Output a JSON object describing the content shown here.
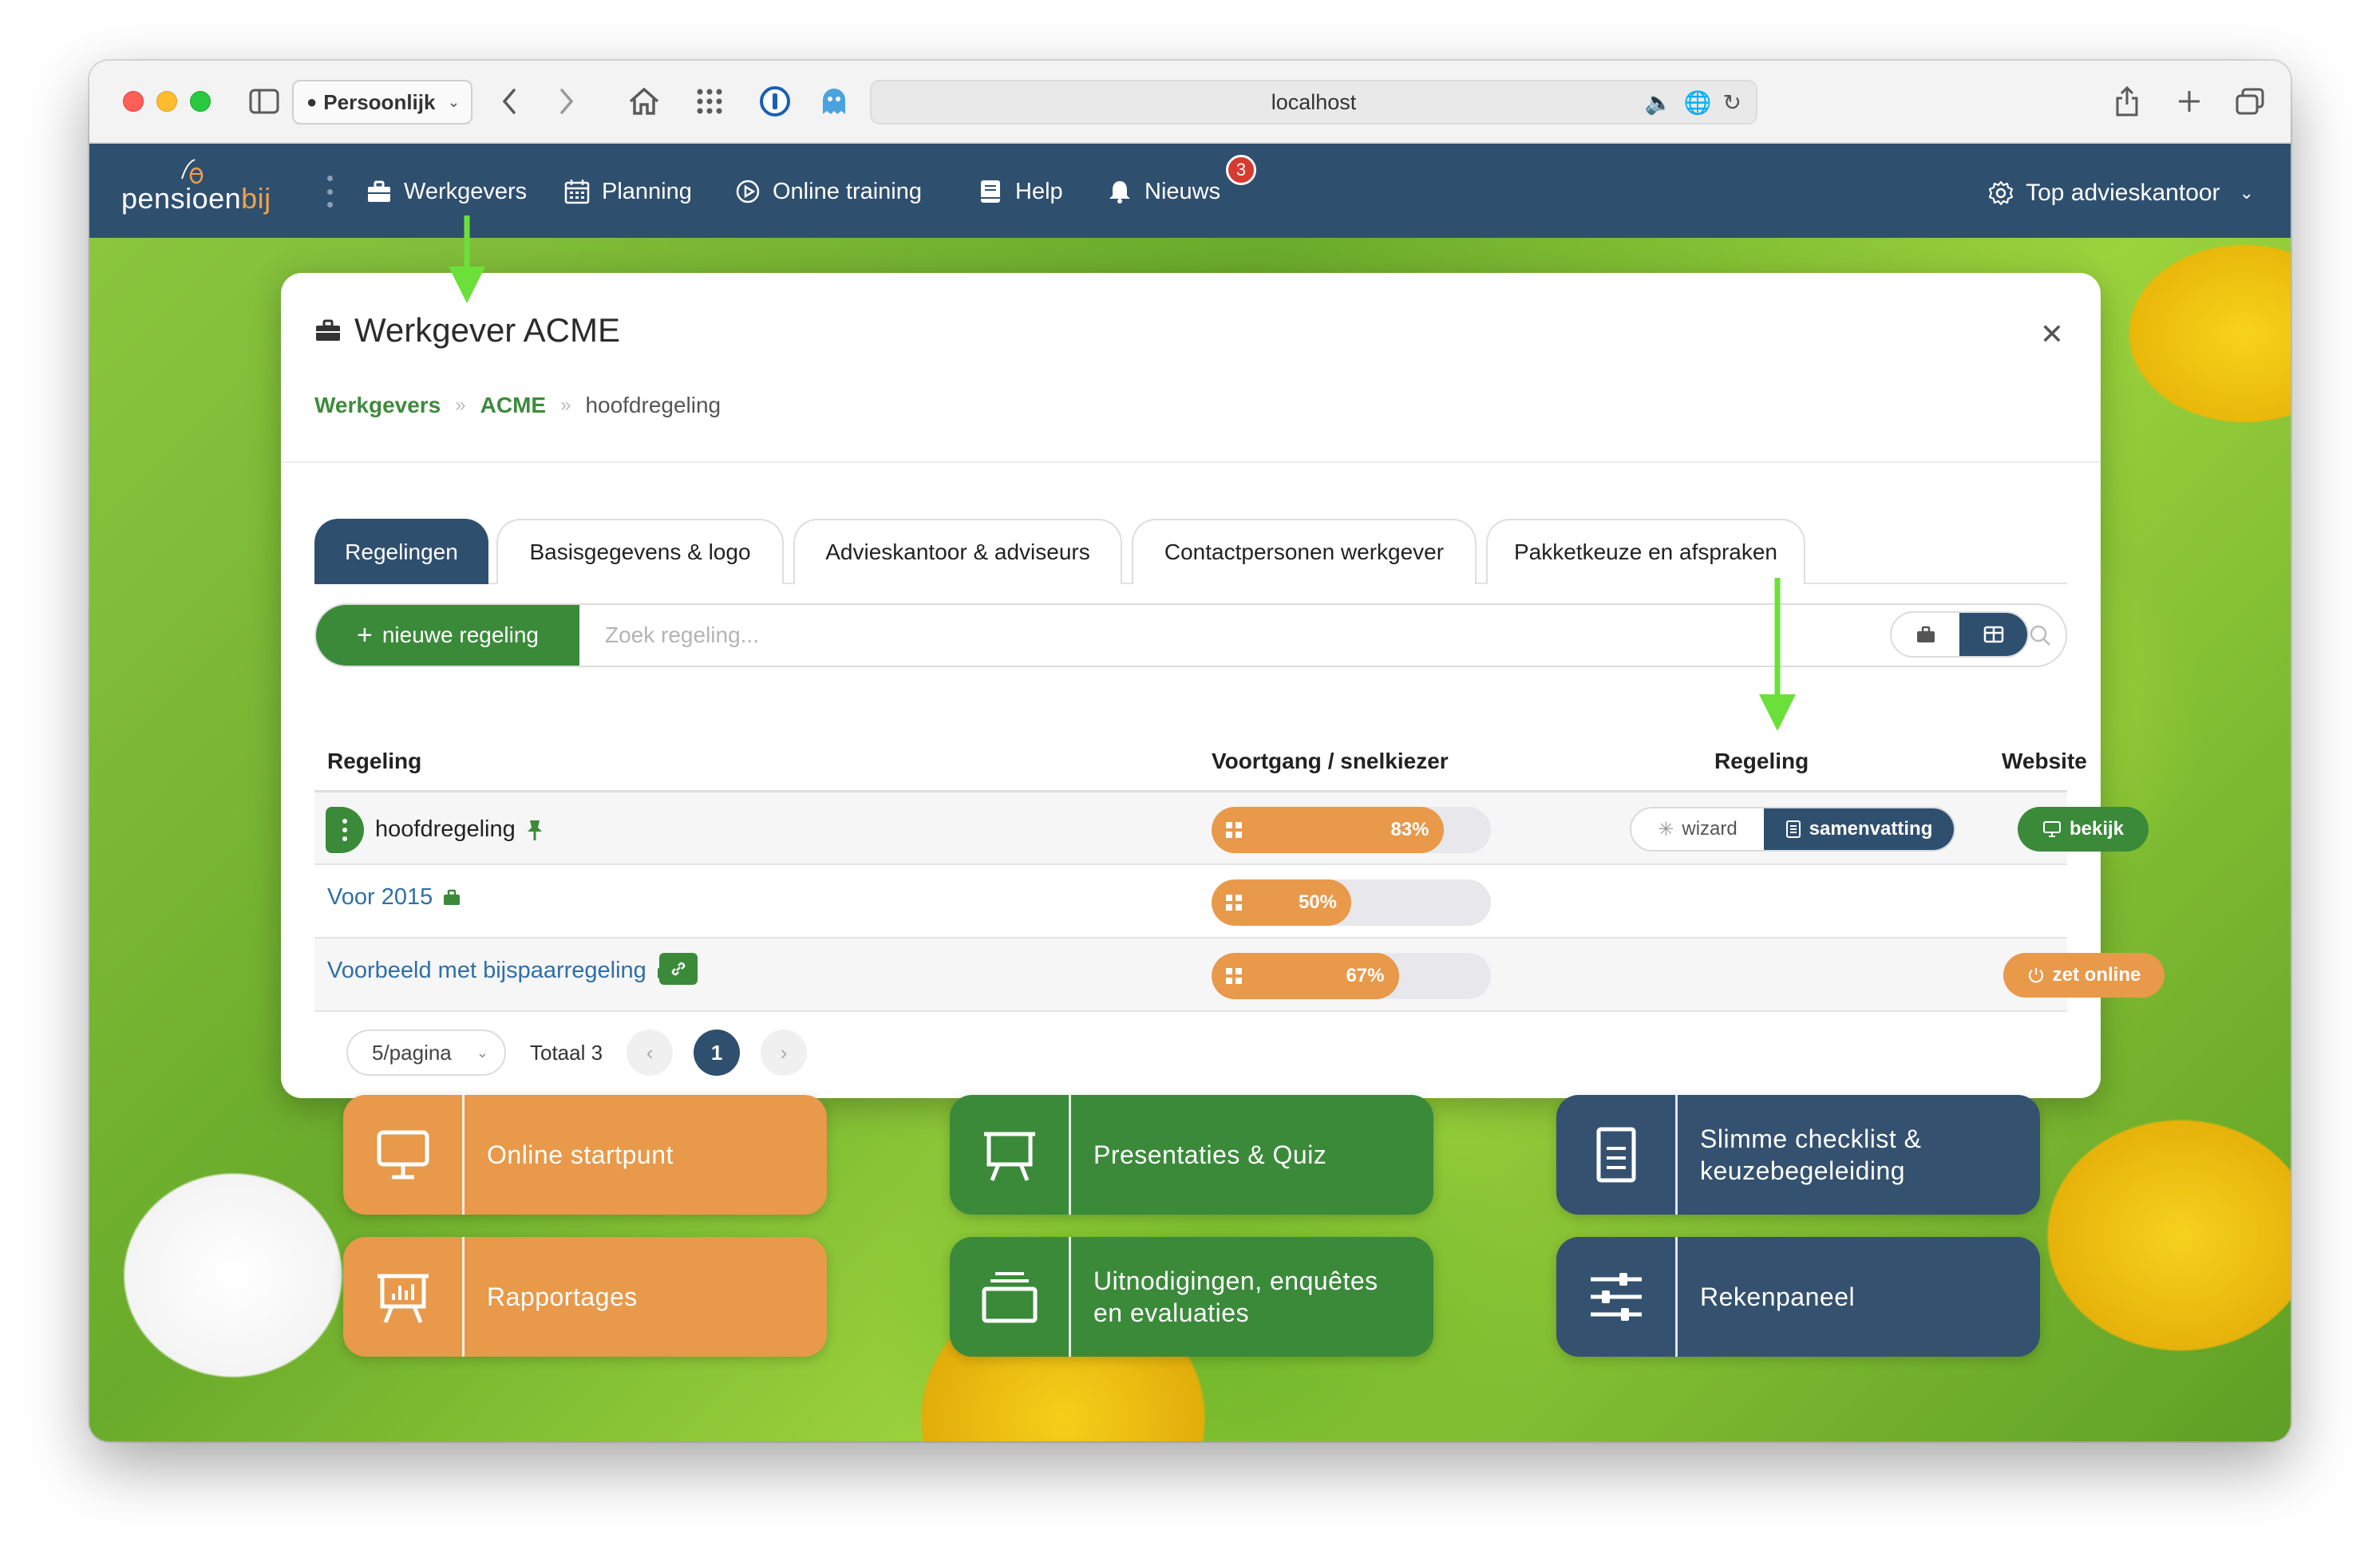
{
  "browser": {
    "profile_label": "Persoonlijk",
    "url": "localhost"
  },
  "app": {
    "logo_text_main": "pensioen",
    "logo_text_accent": "bij",
    "nav": [
      {
        "label": "Werkgevers",
        "icon": "briefcase-icon"
      },
      {
        "label": "Planning",
        "icon": "calendar-icon"
      },
      {
        "label": "Online training",
        "icon": "play-circle-icon"
      },
      {
        "label": "Help",
        "icon": "book-icon"
      },
      {
        "label": "Nieuws",
        "icon": "bell-icon"
      }
    ],
    "news_badge": "3",
    "account_label": "Top advieskantoor",
    "colors": {
      "navy": "#2f4f6f",
      "green": "#3a8a3a",
      "orange": "#e8994a"
    }
  },
  "modal": {
    "title": "Werkgever ACME",
    "breadcrumb": [
      "Werkgevers",
      "ACME",
      "hoofdregeling"
    ],
    "tabs": [
      "Regelingen",
      "Basisgegevens & logo",
      "Advieskantoor & adviseurs",
      "Contactpersonen werkgever",
      "Pakketkeuze en afspraken"
    ],
    "new_button_label": "nieuwe regeling",
    "search_placeholder": "Zoek regeling...",
    "columns": [
      "Regeling",
      "Voortgang / snelkiezer",
      "Regeling",
      "Website"
    ],
    "rows": [
      {
        "name": "hoofdregeling",
        "progress": 83,
        "progress_label": "83%",
        "wizard": "wizard",
        "summary": "samenvatting",
        "website_action": "bekijk"
      },
      {
        "name": "Voor 2015",
        "progress": 50,
        "progress_label": "50%"
      },
      {
        "name": "Voorbeeld met bijspaarregeling",
        "progress": 67,
        "progress_label": "67%",
        "website_action": "zet online"
      }
    ],
    "pagination": {
      "per_page": "5/pagina",
      "total": "Totaal 3",
      "current_page": "1"
    }
  },
  "tiles": [
    {
      "label": "Online startpunt",
      "icon": "monitor-icon",
      "color": "orange"
    },
    {
      "label": "Presentaties & Quiz",
      "icon": "presentation-icon",
      "color": "green"
    },
    {
      "label": "Slimme checklist &\nkeuzebegeleiding",
      "icon": "document-icon",
      "color": "blue"
    },
    {
      "label": "Rapportages",
      "icon": "chart-board-icon",
      "color": "orange"
    },
    {
      "label": "Uitnodigingen, enquêtes\nen evaluaties",
      "icon": "inbox-stack-icon",
      "color": "green"
    },
    {
      "label": "Rekenpaneel",
      "icon": "sliders-icon",
      "color": "blue"
    }
  ]
}
